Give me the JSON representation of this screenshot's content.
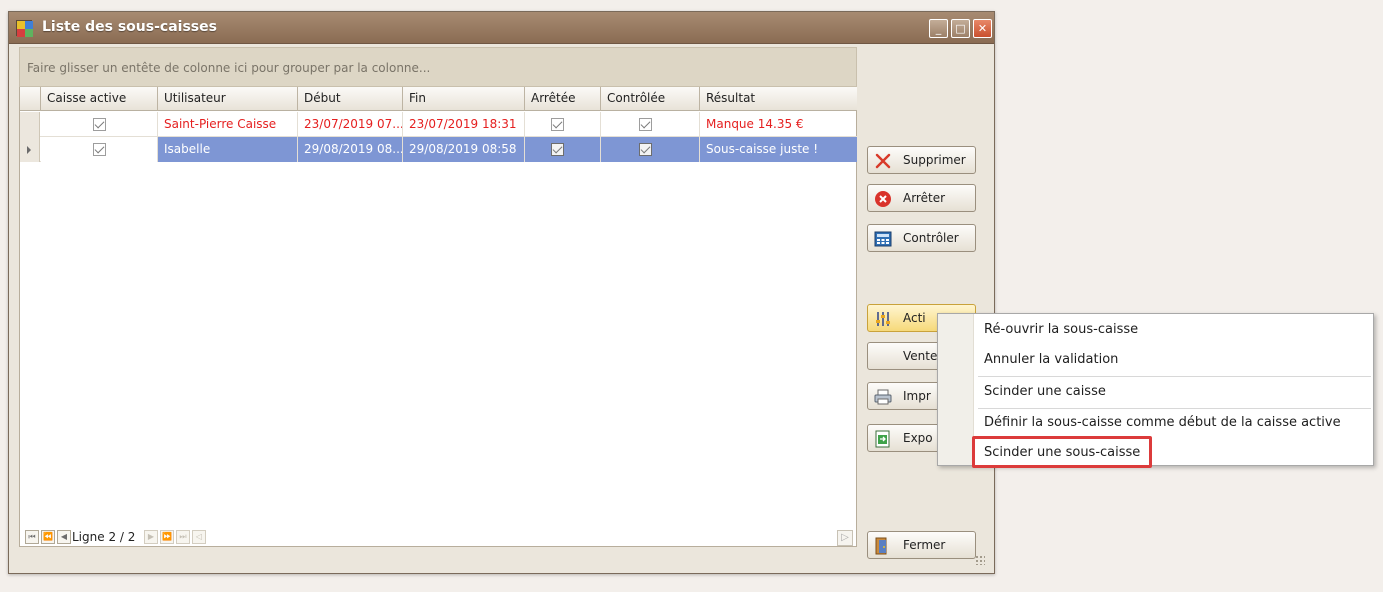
{
  "window": {
    "title": "Liste des sous-caisses",
    "controls": {
      "minimize": "_",
      "maximize": "□",
      "close": "✕"
    }
  },
  "grid": {
    "group_hint": "Faire glisser un entête de colonne ici pour grouper par la colonne...",
    "columns": [
      "Caisse active",
      "Utilisateur",
      "Début",
      "Fin",
      "Arrêtée",
      "Contrôlée",
      "Résultat"
    ],
    "rows": [
      {
        "user": "Saint-Pierre Caisse",
        "debut": "23/07/2019 07...",
        "fin": "23/07/2019 18:31",
        "resultat": "Manque 14.35 €"
      },
      {
        "user": "Isabelle",
        "debut": "29/08/2019 08...",
        "fin": "29/08/2019 08:58",
        "resultat": "Sous-caisse juste !"
      }
    ],
    "navigator": {
      "label": "Ligne 2 / 2"
    }
  },
  "buttons": {
    "supprimer": "Supprimer",
    "arreter": "Arrêter",
    "controler": "Contrôler",
    "actions": "Acti",
    "ventes": "Vente",
    "imprimer": "Impr",
    "exporter": "Expo",
    "fermer": "Fermer"
  },
  "context_menu": {
    "items": [
      "Ré-ouvrir la sous-caisse",
      "Annuler la validation",
      "Scinder une caisse",
      "Définir la sous-caisse comme début de la caisse active",
      "Scinder une sous-caisse"
    ]
  },
  "colors": {
    "title_bar": "#9b7c62",
    "selection": "#7e96d4",
    "error_text": "#e52020",
    "highlight_box": "#dc3b3b"
  }
}
